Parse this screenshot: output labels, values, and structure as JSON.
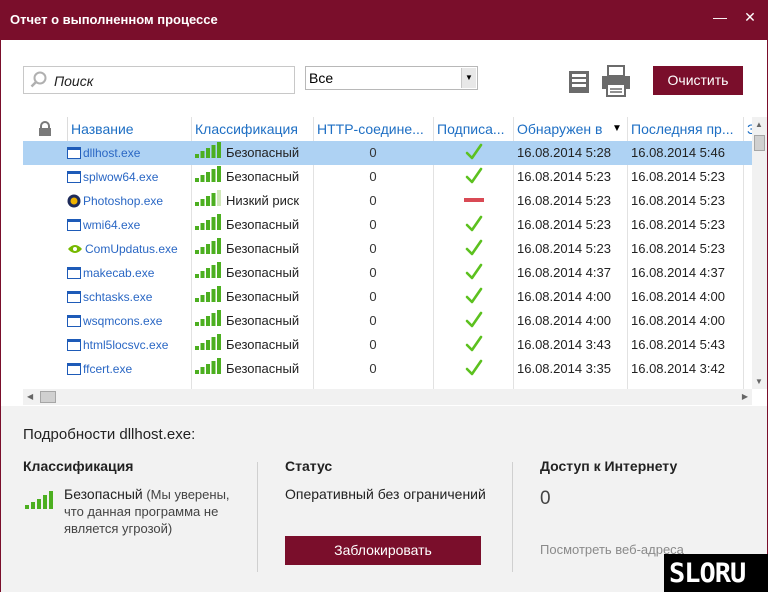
{
  "window": {
    "title": "Отчет о выполненном процессе",
    "minimize_glyph": "—",
    "close_glyph": "✕"
  },
  "toolbar": {
    "search_placeholder": "Поиск",
    "filter_value": "Все",
    "clear_label": "Очистить"
  },
  "table": {
    "columns": [
      "Название",
      "Классификация",
      "HTTP-соедине...",
      "Подписа...",
      "Обнаружен в",
      "Последняя пр...",
      "З"
    ],
    "rows": [
      {
        "name": "dllhost.exe",
        "classification": "Безопасный",
        "level": 5,
        "http": "0",
        "signed": "yes",
        "found": "16.08.2014 5:28",
        "last": "16.08.2014 5:46",
        "selected": true
      },
      {
        "name": "splwow64.exe",
        "classification": "Безопасный",
        "level": 5,
        "http": "0",
        "signed": "yes",
        "found": "16.08.2014 5:23",
        "last": "16.08.2014 5:23",
        "selected": false
      },
      {
        "name": "Photoshop.exe",
        "classification": "Низкий риск",
        "level": 4,
        "http": "0",
        "signed": "no",
        "found": "16.08.2014 5:23",
        "last": "16.08.2014 5:23",
        "selected": false
      },
      {
        "name": "wmi64.exe",
        "classification": "Безопасный",
        "level": 5,
        "http": "0",
        "signed": "yes",
        "found": "16.08.2014 5:23",
        "last": "16.08.2014 5:23",
        "selected": false
      },
      {
        "name": "ComUpdatus.exe",
        "classification": "Безопасный",
        "level": 5,
        "http": "0",
        "signed": "yes",
        "found": "16.08.2014 5:23",
        "last": "16.08.2014 5:23",
        "selected": false
      },
      {
        "name": "makecab.exe",
        "classification": "Безопасный",
        "level": 5,
        "http": "0",
        "signed": "yes",
        "found": "16.08.2014 4:37",
        "last": "16.08.2014 4:37",
        "selected": false
      },
      {
        "name": "schtasks.exe",
        "classification": "Безопасный",
        "level": 5,
        "http": "0",
        "signed": "yes",
        "found": "16.08.2014 4:00",
        "last": "16.08.2014 4:00",
        "selected": false
      },
      {
        "name": "wsqmcons.exe",
        "classification": "Безопасный",
        "level": 5,
        "http": "0",
        "signed": "yes",
        "found": "16.08.2014 4:00",
        "last": "16.08.2014 4:00",
        "selected": false
      },
      {
        "name": "html5locsvc.exe",
        "classification": "Безопасный",
        "level": 5,
        "http": "0",
        "signed": "yes",
        "found": "16.08.2014 3:43",
        "last": "16.08.2014 5:43",
        "selected": false
      },
      {
        "name": "ffcert.exe",
        "classification": "Безопасный",
        "level": 5,
        "http": "0",
        "signed": "yes",
        "found": "16.08.2014 3:35",
        "last": "16.08.2014 3:42",
        "selected": false
      }
    ]
  },
  "details": {
    "title": "Подробности dllhost.exe:",
    "classification_header": "Классификация",
    "classification_value": "Безопасный",
    "classification_note": "(Мы уверены, что данная программа не является угрозой)",
    "status_header": "Статус",
    "status_value": "Оперативный без ограничений",
    "block_label": "Заблокировать",
    "internet_header": "Доступ к Интернету",
    "internet_value": "0",
    "web_link": "Посмотреть веб-адреса"
  },
  "watermark": "SLORU",
  "colors": {
    "accent": "#7a0e2b",
    "link": "#1e6fc4",
    "selection": "#aed2f3",
    "check": "#5cc11f",
    "dash": "#d94a55"
  }
}
